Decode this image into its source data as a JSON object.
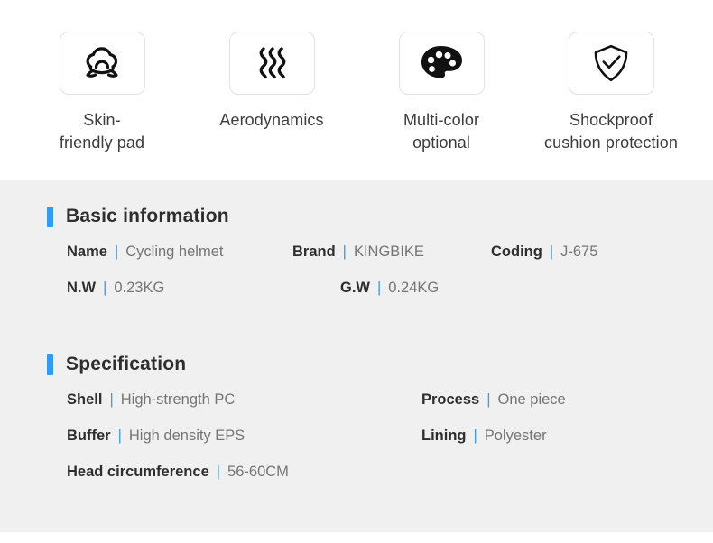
{
  "features": [
    {
      "icon": "helmet-pad-icon",
      "label": "Skin-\nfriendly pad"
    },
    {
      "icon": "aerodynamics-waves-icon",
      "label": "Aerodynamics"
    },
    {
      "icon": "paint-palette-icon",
      "label": "Multi-color\noptional"
    },
    {
      "icon": "shield-check-icon",
      "label": "Shockproof\ncushion protection"
    }
  ],
  "basic_information": {
    "title": "Basic information",
    "separator": "|",
    "rows": [
      [
        {
          "label": "Name",
          "value": "Cycling helmet"
        },
        {
          "label": "Brand",
          "value": "KINGBIKE"
        },
        {
          "label": "Coding",
          "value": "J-675"
        }
      ],
      [
        {
          "label": "N.W",
          "value": "0.23KG"
        },
        {
          "label": "G.W",
          "value": "0.24KG"
        }
      ]
    ]
  },
  "specification": {
    "title": "Specification",
    "separator": "|",
    "rows": [
      [
        {
          "label": "Shell",
          "value": "High-strength PC"
        },
        {
          "label": "Process",
          "value": "One piece"
        }
      ],
      [
        {
          "label": "Buffer",
          "value": "High density EPS"
        },
        {
          "label": "Lining",
          "value": "Polyester"
        }
      ],
      [
        {
          "label": "Head circumference",
          "value": "56-60CM"
        }
      ]
    ]
  },
  "colors": {
    "accent_blue": "#2f9bf5",
    "separator_blue": "#3d9ae8",
    "panel_background": "#f0f0f0",
    "label_text": "#2e2e2e",
    "value_text": "#757575"
  }
}
